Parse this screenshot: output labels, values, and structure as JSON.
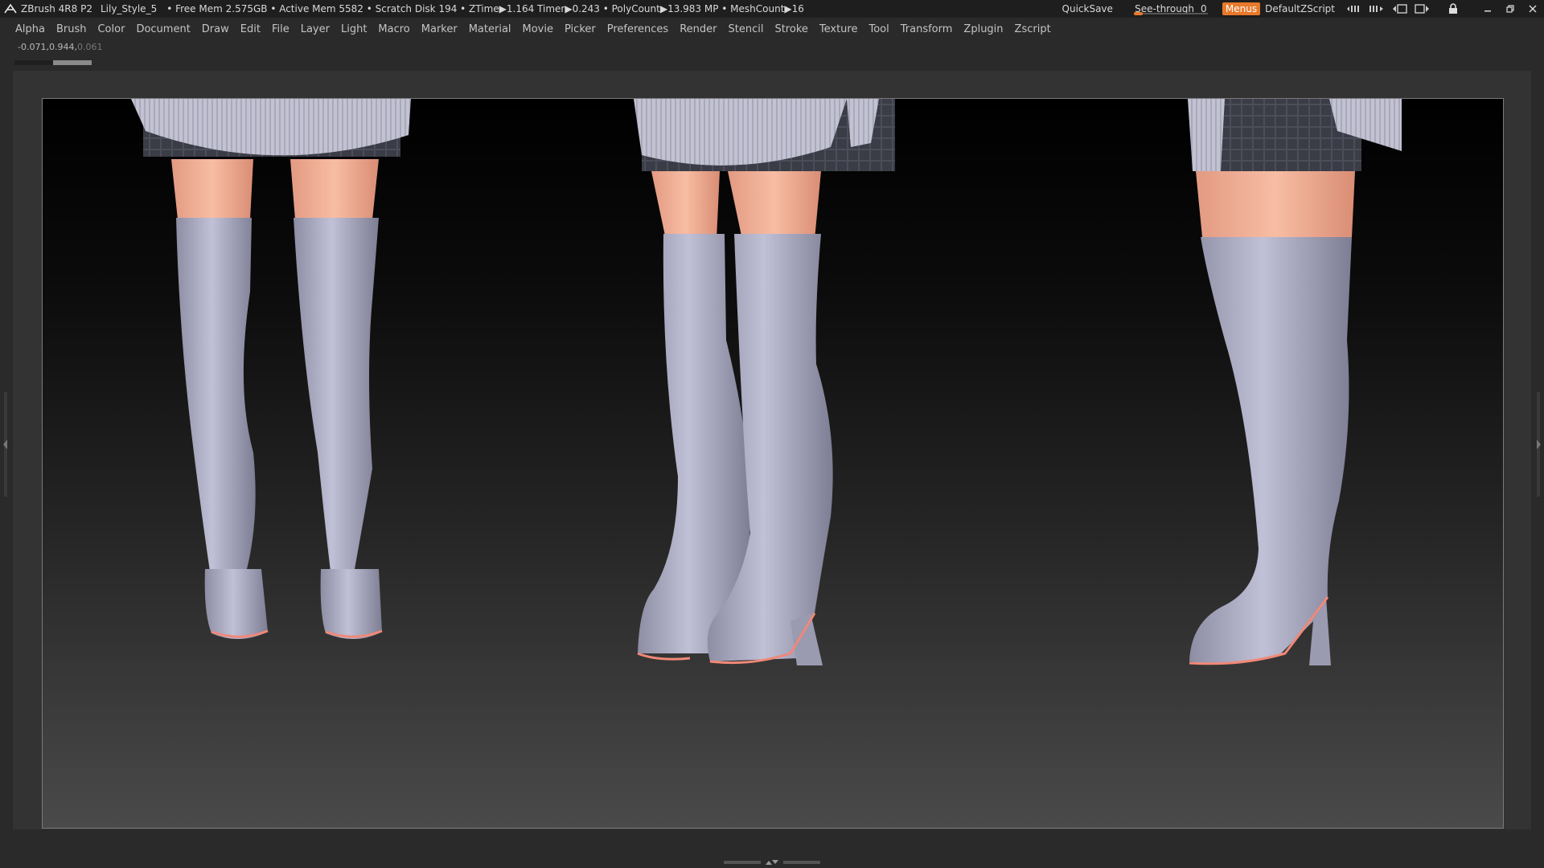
{
  "titlebar": {
    "app_title": "ZBrush 4R8 P2",
    "document_name": "Lily_Style_5",
    "stats": "• Free Mem 2.575GB • Active Mem 5582 • Scratch Disk 194 •  ZTime▶1.164 Timer▶0.243 • PolyCount▶13.983 MP  • MeshCount▶16",
    "quicksave_label": "QuickSave",
    "seethrough_label": "See-through",
    "seethrough_value": "0",
    "seethrough_fraction": 0.12,
    "menus_label": "Menus",
    "script_label": "DefaultZScript",
    "accent_color": "#e8792a"
  },
  "menubar": {
    "items": [
      "Alpha",
      "Brush",
      "Color",
      "Document",
      "Draw",
      "Edit",
      "File",
      "Layer",
      "Light",
      "Macro",
      "Marker",
      "Material",
      "Movie",
      "Picker",
      "Preferences",
      "Render",
      "Stencil",
      "Stroke",
      "Texture",
      "Tool",
      "Transform",
      "Zplugin",
      "Zscript"
    ]
  },
  "coords": {
    "x": "-0.071",
    "y": "0.944",
    "z": "0.061"
  },
  "icons": {
    "logo": "zbrush-logo-icon",
    "lock": "lock-icon",
    "minimize": "minimize-icon",
    "restore": "restore-icon",
    "close": "close-icon"
  },
  "colors": {
    "boot": "#a9a9bf",
    "skin": "#f4b49a",
    "sweater": "#c4c4d4",
    "skirt": "#3b3d47",
    "sole": "#f08878"
  }
}
